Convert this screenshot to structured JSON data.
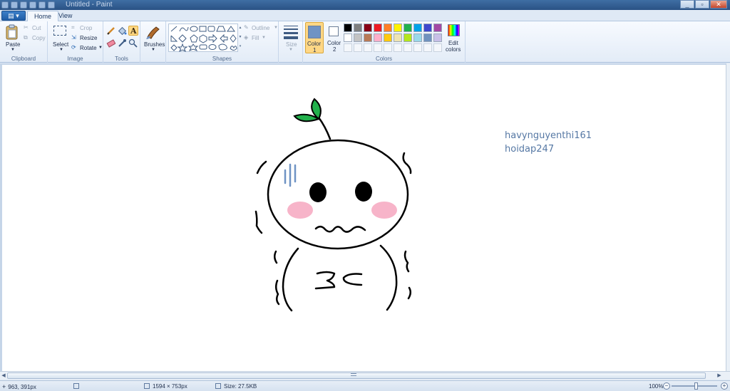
{
  "window": {
    "title": "Untitled - Paint"
  },
  "tabs": {
    "home": "Home",
    "view": "View"
  },
  "ribbon": {
    "clipboard": {
      "paste": "Paste",
      "cut": "Cut",
      "copy": "Copy",
      "group": "Clipboard"
    },
    "image": {
      "select": "Select",
      "crop": "Crop",
      "resize": "Resize",
      "rotate": "Rotate",
      "group": "Image"
    },
    "tools": {
      "group": "Tools"
    },
    "brushes": {
      "label": "Brushes"
    },
    "shapes": {
      "outline": "Outline",
      "fill": "Fill",
      "group": "Shapes"
    },
    "size": {
      "label": "Size"
    },
    "colors": {
      "color1": "Color",
      "color1_num": "1",
      "color2": "Color",
      "color2_num": "2",
      "edit": "Edit",
      "edit2": "colors",
      "group": "Colors",
      "color1_value": "#6f93c4",
      "color2_value": "#ffffff",
      "palette_row1": [
        "#000000",
        "#7f7f7f",
        "#880015",
        "#ed1c24",
        "#ff7f27",
        "#fff200",
        "#22b14c",
        "#00a2e8",
        "#3f48cc",
        "#a349a4"
      ],
      "palette_row2": [
        "#ffffff",
        "#c3c3c3",
        "#b97a57",
        "#ffaec9",
        "#ffc90e",
        "#efe4b0",
        "#b5e61d",
        "#99d9ea",
        "#7092be",
        "#c8bfe7"
      ]
    }
  },
  "canvas": {
    "text_line1": "havynguyenthi161",
    "text_line2": "hoidap247"
  },
  "status": {
    "cursor": "963, 391px",
    "image_size": "1594 × 753px",
    "file_size": "Size: 27.5KB",
    "zoom": "100%"
  }
}
